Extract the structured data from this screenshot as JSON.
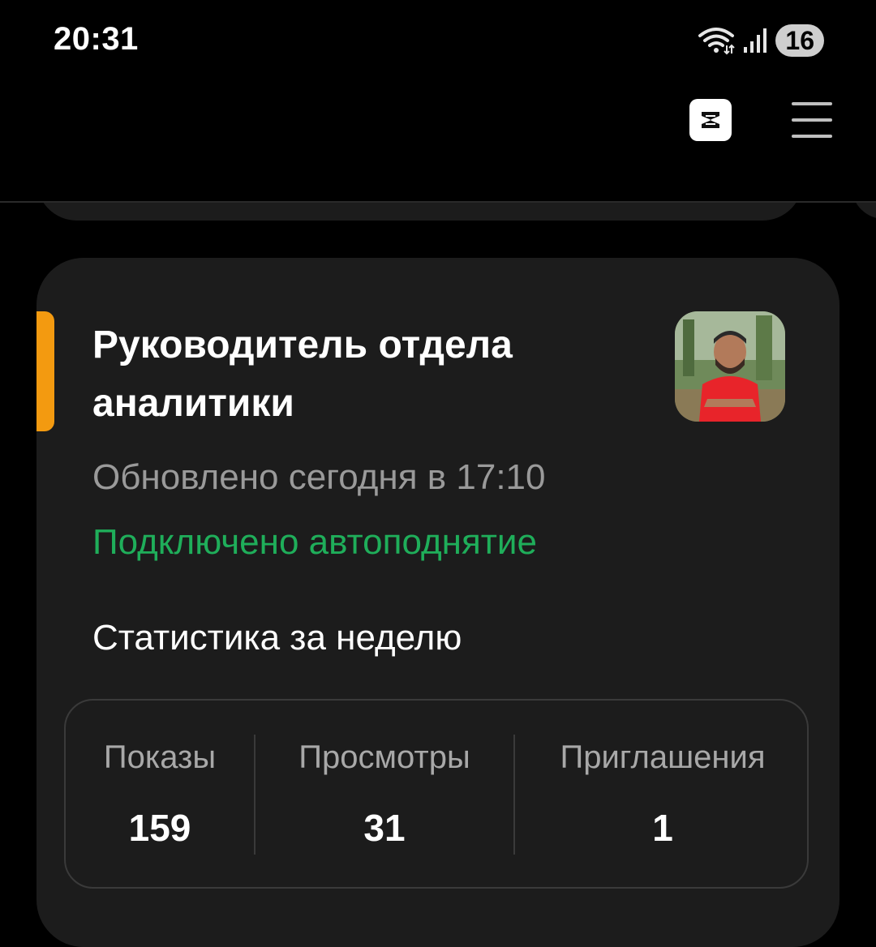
{
  "status_bar": {
    "time": "20:31",
    "battery": "16"
  },
  "header": {
    "logo_icon": "app-logo-icon",
    "menu_icon": "hamburger-menu-icon"
  },
  "vacancy": {
    "title": "Руководитель отдела аналитики",
    "updated": "Обновлено сегодня в 17:10",
    "autoboost": "Подключено автоподнятие",
    "accent_color": "#f39a10",
    "autoboost_color": "#1fae5a",
    "stats_heading": "Статистика за неделю",
    "stats": [
      {
        "label": "Показы",
        "value": "159"
      },
      {
        "label": "Просмотры",
        "value": "31"
      },
      {
        "label": "Приглашения",
        "value": "1"
      }
    ]
  }
}
